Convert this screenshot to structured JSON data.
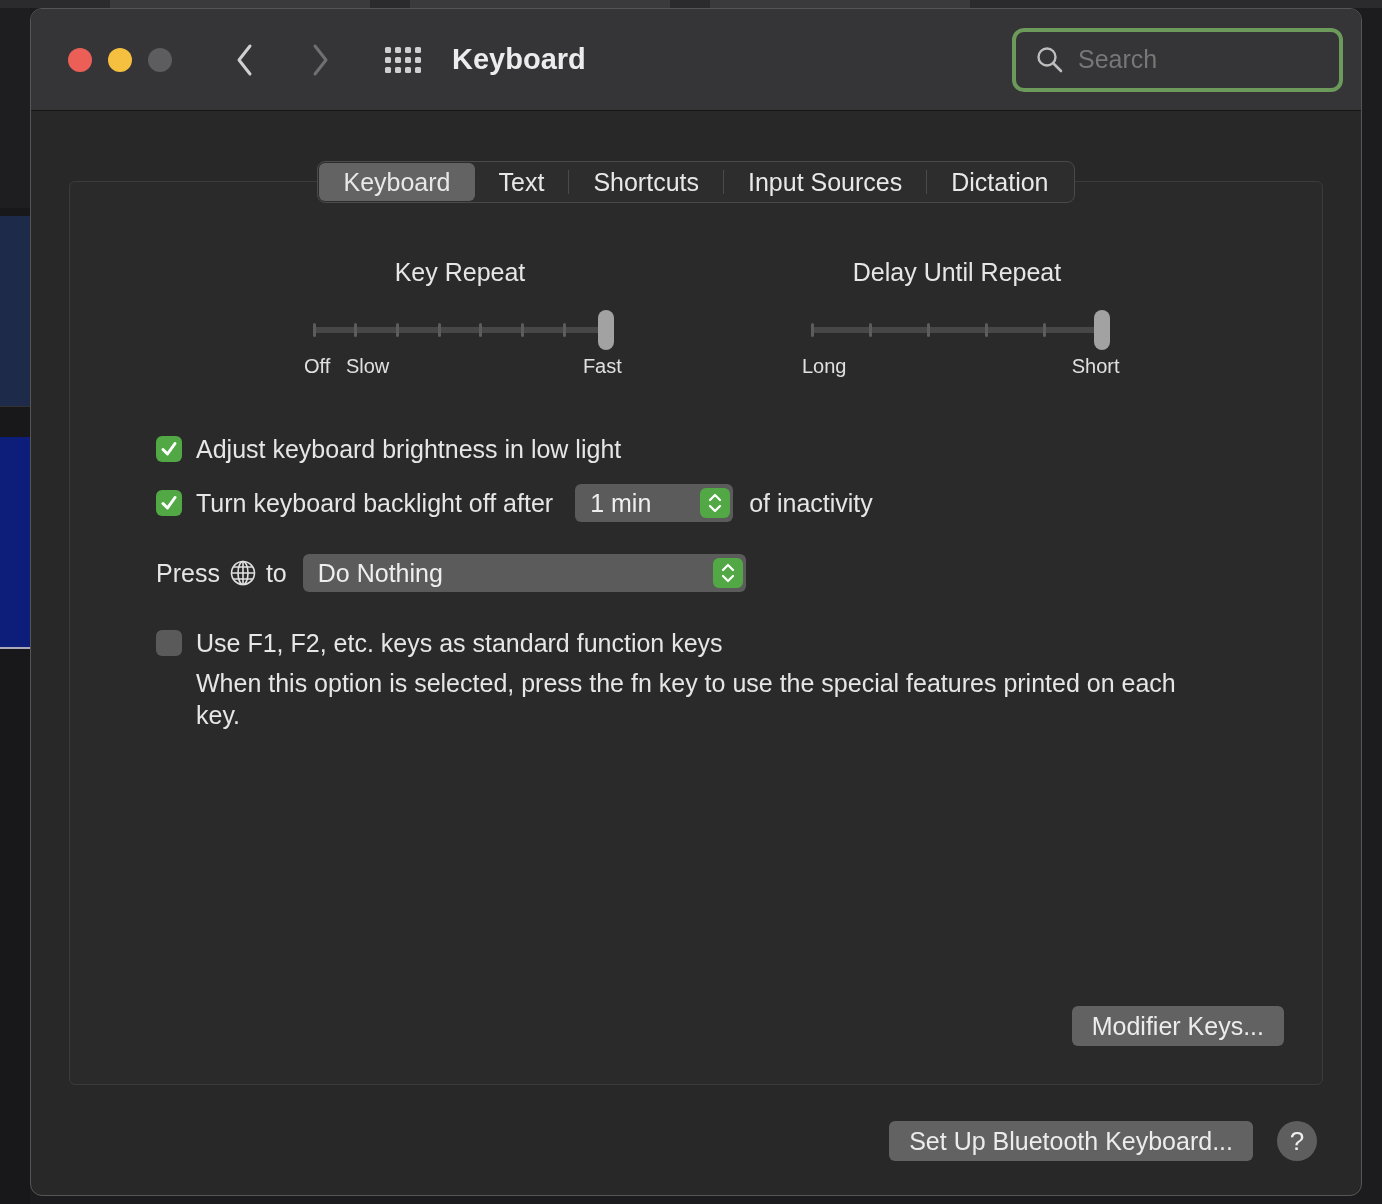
{
  "window": {
    "title": "Keyboard",
    "search": {
      "placeholder": "Search"
    }
  },
  "tabs": [
    {
      "label": "Keyboard",
      "selected": true
    },
    {
      "label": "Text",
      "selected": false
    },
    {
      "label": "Shortcuts",
      "selected": false
    },
    {
      "label": "Input Sources",
      "selected": false
    },
    {
      "label": "Dictation",
      "selected": false
    }
  ],
  "sliders": [
    {
      "title": "Key Repeat",
      "level": 1,
      "labels": [
        "Off",
        "Slow",
        "Fast"
      ]
    },
    {
      "title": "Delay Until Repeat",
      "level": 1,
      "labels": [
        "Long",
        "Short"
      ]
    }
  ],
  "options": [
    {
      "kind": "checkbox",
      "label": "Adjust keyboard brightness in low light",
      "checked": true
    },
    {
      "kind": "checkbox-popup",
      "label": "Turn keyboard backlight off after",
      "checked": true,
      "value": "1 min",
      "suffix": "of inactivity"
    },
    {
      "kind": "globe-popup",
      "prefix": "Press",
      "suffix": "to",
      "value": "Do Nothing"
    },
    {
      "kind": "checkbox",
      "label": "Use F1, F2, etc. keys as standard function keys",
      "checked": false,
      "description": "When this option is selected, press the fn key to use the special features printed on each key."
    }
  ],
  "buttons": {
    "panel": "Modifier Keys...",
    "footer": "Set Up Bluetooth Keyboard...",
    "help": "?"
  }
}
